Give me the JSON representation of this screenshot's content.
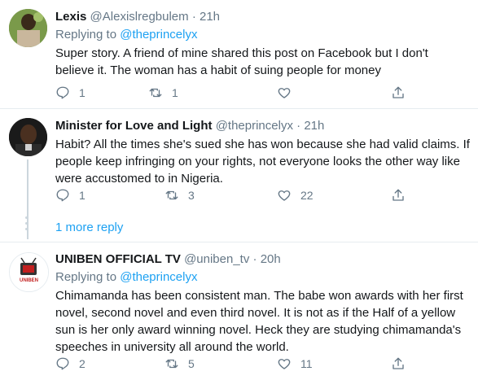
{
  "tweets": [
    {
      "name": "Lexis",
      "handle": "@Alexislregbulem",
      "dot": "·",
      "time": "21h",
      "replying_prefix": "Replying to",
      "replying_to": "@theprincelyx",
      "text": "Super story. A friend of mine shared this post on Facebook but I don't believe it. The woman has a habit of suing people for money",
      "replies": "1",
      "retweets": "1",
      "likes": ""
    },
    {
      "name": "Minister for Love and Light",
      "handle": "@theprincelyx",
      "dot": "·",
      "time": "21h",
      "text": "Habit? All the times she's sued she has won because she had valid claims. If people keep infringing on your rights, not everyone looks the other way like were accustomed to in Nigeria.",
      "replies": "1",
      "retweets": "3",
      "likes": "22"
    },
    {
      "name": "UNIBEN OFFICIAL TV",
      "handle": "@uniben_tv",
      "dot": "·",
      "time": "20h",
      "replying_prefix": "Replying to",
      "replying_to": "@theprincelyx",
      "text": "Chimamanda has been consistent man. The babe won awards with her first novel, second novel and even third novel. It is not as if the Half of a yellow sun is her only award winning novel. Heck they are studying chimamanda's speeches in university all around the world.",
      "replies": "2",
      "retweets": "5",
      "likes": "11"
    }
  ],
  "thread": {
    "more_reply": "1 more reply"
  },
  "avatar_logo_text": "UNIBEN",
  "colors": {
    "link": "#1da1f2",
    "muted": "#657786",
    "divider": "#e6ecf0"
  }
}
